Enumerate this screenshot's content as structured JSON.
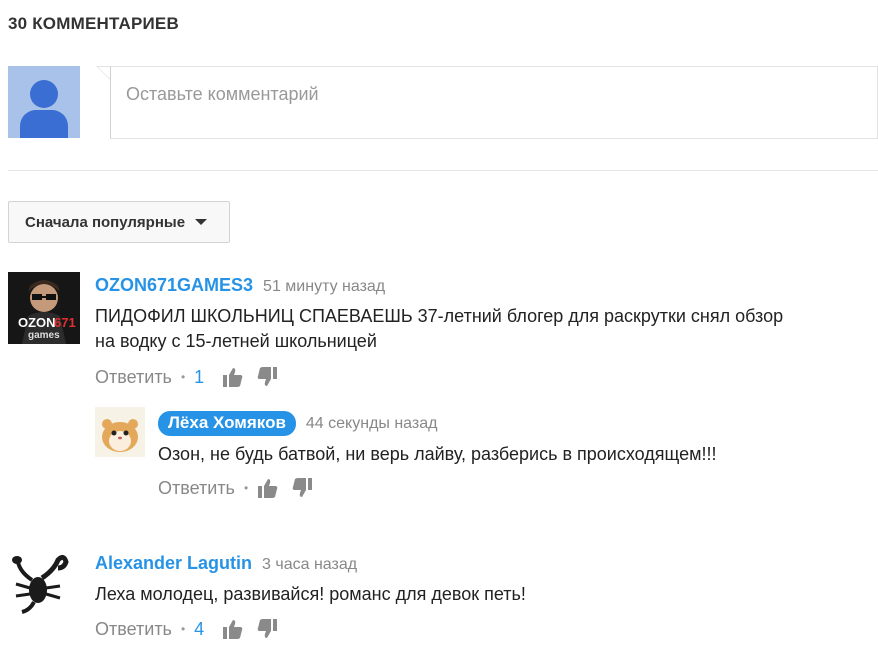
{
  "comments_header": {
    "title": "30 КОММЕНТАРИЕВ"
  },
  "composer": {
    "placeholder": "Оставьте комментарий"
  },
  "sort": {
    "label": "Сначала популярные"
  },
  "comments": [
    {
      "author": "OZON671GAMES3",
      "time": "51 минуту назад",
      "text_line1": "ПИДОФИЛ ШКОЛЬНИЦ СПАЕВАЕШЬ 37-летний блогер для раскрутки снял обзор",
      "text_line2": "на водку с 15-летней школьницей",
      "reply_label": "Ответить",
      "likes": "1",
      "replies": [
        {
          "author": "Лёха Хомяков",
          "time": "44 секунды назад",
          "text": "Озон, не будь батвой, ни верь лайву, разберись в происходящем!!!",
          "reply_label": "Ответить"
        }
      ]
    },
    {
      "author": "Alexander Lagutin",
      "time": "3 часа назад",
      "text": "Леха молодец, развивайся! романс для девок петь!",
      "reply_label": "Ответить",
      "likes": "4"
    }
  ],
  "colors": {
    "link": "#2793e6",
    "muted": "#888888",
    "avatar_default_bg": "#a9c2ea",
    "avatar_default_fg": "#3b6ed2"
  },
  "icons": [
    "default-avatar-icon",
    "thumbs-up-icon",
    "thumbs-down-icon",
    "caret-down-icon"
  ]
}
